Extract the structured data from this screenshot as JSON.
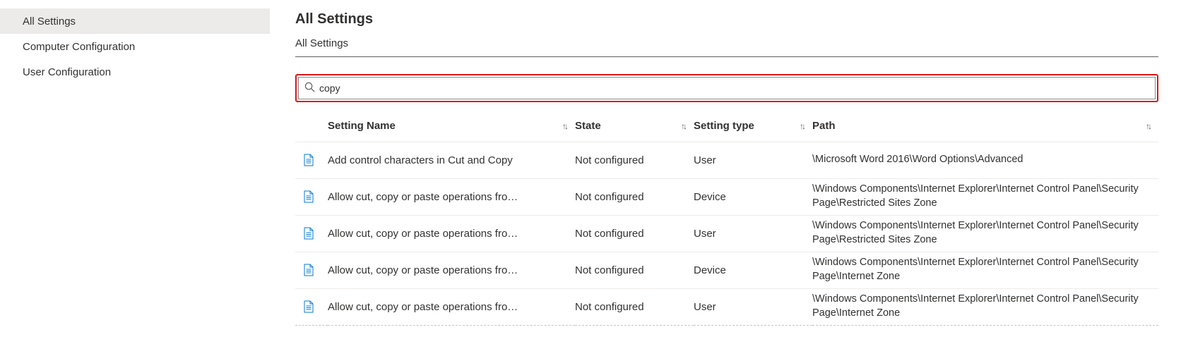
{
  "sidebar": {
    "items": [
      {
        "label": "All Settings",
        "selected": true
      },
      {
        "label": "Computer Configuration",
        "selected": false
      },
      {
        "label": "User Configuration",
        "selected": false
      }
    ]
  },
  "header": {
    "title": "All Settings",
    "breadcrumb": "All Settings"
  },
  "search": {
    "value": "copy"
  },
  "table": {
    "columns": [
      "Setting Name",
      "State",
      "Setting type",
      "Path"
    ],
    "rows": [
      {
        "name": "Add control characters in Cut and Copy",
        "state": "Not configured",
        "type": "User",
        "path": "\\Microsoft Word 2016\\Word Options\\Advanced"
      },
      {
        "name": "Allow cut, copy or paste operations fro…",
        "state": "Not configured",
        "type": "Device",
        "path": "\\Windows Components\\Internet Explorer\\Internet Control Panel\\Security Page\\Restricted Sites Zone"
      },
      {
        "name": "Allow cut, copy or paste operations fro…",
        "state": "Not configured",
        "type": "User",
        "path": "\\Windows Components\\Internet Explorer\\Internet Control Panel\\Security Page\\Restricted Sites Zone"
      },
      {
        "name": "Allow cut, copy or paste operations fro…",
        "state": "Not configured",
        "type": "Device",
        "path": "\\Windows Components\\Internet Explorer\\Internet Control Panel\\Security Page\\Internet Zone"
      },
      {
        "name": "Allow cut, copy or paste operations fro…",
        "state": "Not configured",
        "type": "User",
        "path": "\\Windows Components\\Internet Explorer\\Internet Control Panel\\Security Page\\Internet Zone"
      }
    ]
  }
}
